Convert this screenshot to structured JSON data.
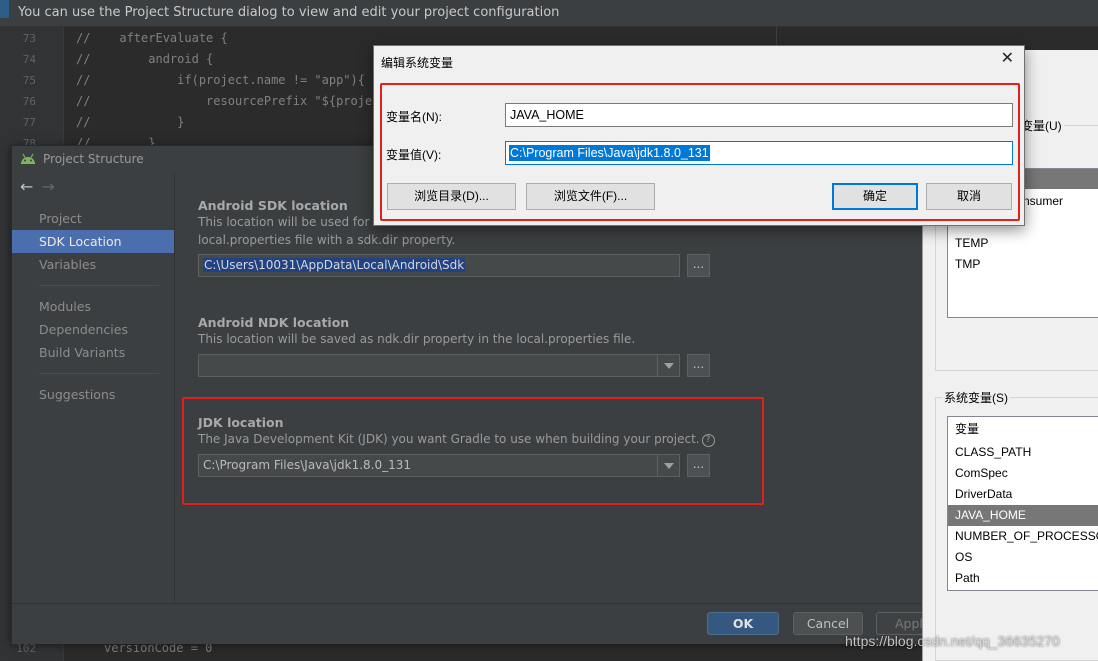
{
  "ide": {
    "tip": "You can use the Project Structure dialog to view and edit your project configuration",
    "code": [
      {
        "ln": "73",
        "text": "//    afterEvaluate {"
      },
      {
        "ln": "74",
        "text": "//        android {"
      },
      {
        "ln": "75",
        "text": "//            if(project.name != \"app\"){"
      },
      {
        "ln": "76",
        "text": "//                resourcePrefix \"${project"
      },
      {
        "ln": "77",
        "text": "//            }"
      },
      {
        "ln": "78",
        "text": "//        }"
      }
    ],
    "bottom_line": {
      "ln": "102",
      "text": "versionCode = 0"
    }
  },
  "project_structure": {
    "title": "Project Structure",
    "nav": {
      "back_arrow": "←",
      "forward_arrow": "→",
      "items": [
        "Project",
        "SDK Location",
        "Variables",
        "Modules",
        "Dependencies",
        "Build Variants",
        "Suggestions"
      ],
      "selected": "SDK Location"
    },
    "sdk": {
      "title": "Android SDK location",
      "desc1": "This location will be used for r",
      "desc1_tail": "",
      "desc2": "local.properties file with a sdk.dir property.",
      "path": "C:\\Users\\10031\\AppData\\Local\\Android\\Sdk",
      "browse": "..."
    },
    "ndk": {
      "title": "Android NDK location",
      "desc": "This location will be saved as ndk.dir property in the local.properties file.",
      "path": "",
      "browse": "..."
    },
    "jdk": {
      "title": "JDK location",
      "desc": "The Java Development Kit (JDK) you want Gradle to use when building your project.",
      "help": "?",
      "path": "C:\\Program Files\\Java\\jdk1.8.0_131",
      "browse": "..."
    },
    "buttons": {
      "ok": "OK",
      "cancel": "Cancel",
      "apply": "Appl"
    }
  },
  "env_panel": {
    "user_group_label": "变量(U)",
    "user_vars": [
      "nsumer",
      "TEMP",
      "TMP"
    ],
    "system_group_label": "系统变量(S)",
    "system_header": "变量",
    "system_vars": [
      "CLASS_PATH",
      "ComSpec",
      "DriverData",
      "JAVA_HOME",
      "NUMBER_OF_PROCESSO",
      "OS",
      "Path"
    ],
    "system_selected": "JAVA_HOME"
  },
  "edit_dialog": {
    "title": "编辑系统变量",
    "close": "✕",
    "name_label": "变量名(N):",
    "name_value": "JAVA_HOME",
    "value_label": "变量值(V):",
    "value_value": "C:\\Program Files\\Java\\jdk1.8.0_131",
    "browse_dir": "浏览目录(D)...",
    "browse_file": "浏览文件(F)...",
    "ok": "确定",
    "cancel": "取消"
  },
  "watermark": "https://blog.csdn.net/qq_36635270",
  "colors": {
    "highlight": "#e0201b",
    "selection": "#4b6eaf",
    "win_accent": "#0078d7"
  }
}
